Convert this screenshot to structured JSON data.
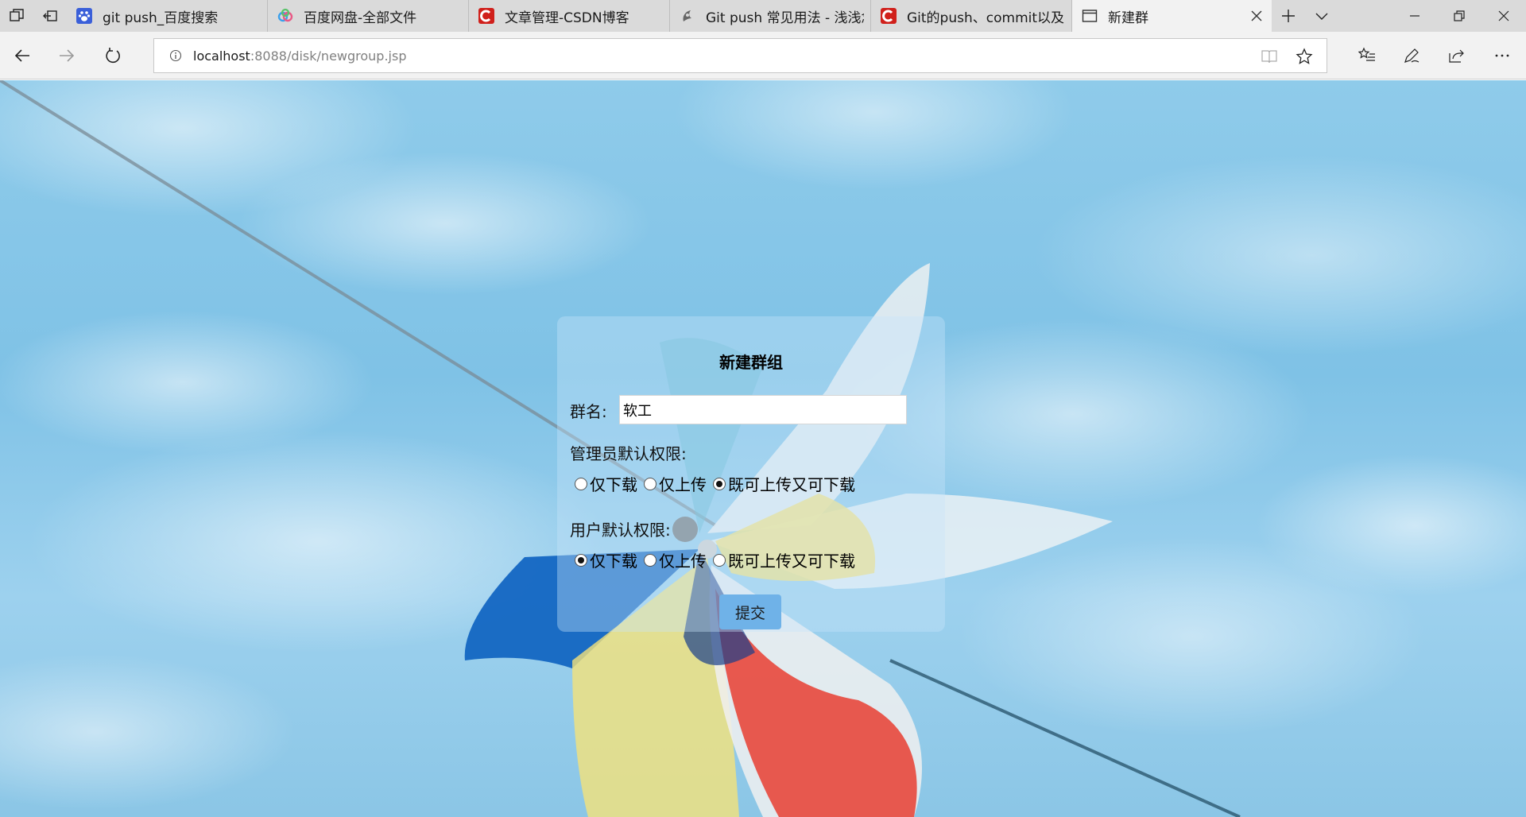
{
  "browser": {
    "tabs": [
      {
        "title": "git push_百度搜索",
        "favicon": "baidu-paw-icon",
        "color": "#3a5fd9"
      },
      {
        "title": "百度网盘-全部文件",
        "favicon": "baidu-netdisk-icon",
        "color": "#4a9be8"
      },
      {
        "title": "文章管理-CSDN博客",
        "favicon": "csdn-icon",
        "color": "#d0201b"
      },
      {
        "title": "Git push 常见用法 - 浅浅念",
        "favicon": "git-site-icon",
        "color": "#555555"
      },
      {
        "title": "Git的push、commit以及pu",
        "favicon": "csdn-icon",
        "color": "#d0201b"
      },
      {
        "title": "新建群",
        "favicon": "page-icon",
        "color": "#444444",
        "active": true
      }
    ],
    "address": {
      "host": "localhost",
      "path": ":8088/disk/newgroup.jsp"
    }
  },
  "form": {
    "title": "新建群组",
    "name_label": "群名:",
    "name_value": "软工",
    "admin_label": "管理员默认权限:",
    "admin_options": [
      {
        "label": "仅下载",
        "checked": false
      },
      {
        "label": "仅上传",
        "checked": false
      },
      {
        "label": "既可上传又可下载",
        "checked": true
      }
    ],
    "user_label": "用户默认权限:",
    "user_options": [
      {
        "label": "仅下载",
        "checked": true
      },
      {
        "label": "仅上传",
        "checked": false
      },
      {
        "label": "既可上传又可下载",
        "checked": false
      }
    ],
    "submit_label": "提交"
  },
  "colors": {
    "accent": "#6fb2e8",
    "sky": "#7fc2e6"
  }
}
